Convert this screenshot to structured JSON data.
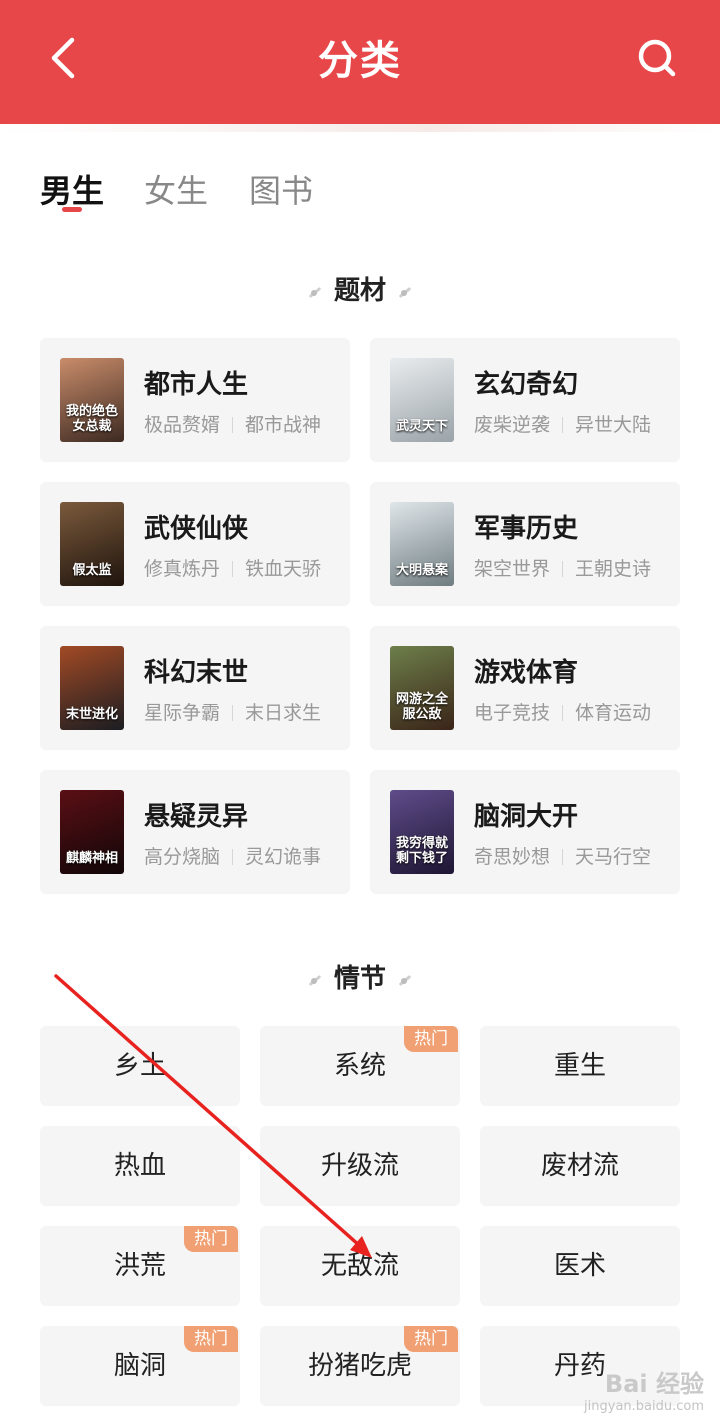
{
  "header": {
    "title": "分类"
  },
  "tabs": [
    {
      "label": "男生",
      "active": true
    },
    {
      "label": "女生",
      "active": false
    },
    {
      "label": "图书",
      "active": false
    }
  ],
  "sections": {
    "theme": "题材",
    "plot": "情节"
  },
  "categories": [
    {
      "title": "都市人生",
      "tags": [
        "极品赘婿",
        "都市战神"
      ],
      "cover_text": "我的绝色女总裁",
      "cover_colors": [
        "#c98c6a",
        "#3d2a22"
      ]
    },
    {
      "title": "玄幻奇幻",
      "tags": [
        "废柴逆袭",
        "异世大陆"
      ],
      "cover_text": "武灵天下",
      "cover_colors": [
        "#e9ecef",
        "#9aa3a8"
      ]
    },
    {
      "title": "武侠仙侠",
      "tags": [
        "修真炼丹",
        "铁血天骄"
      ],
      "cover_text": "假太监",
      "cover_colors": [
        "#7b5a3c",
        "#1f140d"
      ]
    },
    {
      "title": "军事历史",
      "tags": [
        "架空世界",
        "王朝史诗"
      ],
      "cover_text": "大明悬案",
      "cover_colors": [
        "#dfe6ea",
        "#6f7c80"
      ]
    },
    {
      "title": "科幻末世",
      "tags": [
        "星际争霸",
        "末日求生"
      ],
      "cover_text": "末世进化",
      "cover_colors": [
        "#a24a25",
        "#1b1d22"
      ]
    },
    {
      "title": "游戏体育",
      "tags": [
        "电子竞技",
        "体育运动"
      ],
      "cover_text": "网游之全服公敌",
      "cover_colors": [
        "#6d7f4a",
        "#3a2418"
      ]
    },
    {
      "title": "悬疑灵异",
      "tags": [
        "高分烧脑",
        "灵幻诡事"
      ],
      "cover_text": "麒麟神相",
      "cover_colors": [
        "#5a0f14",
        "#100608"
      ]
    },
    {
      "title": "脑洞大开",
      "tags": [
        "奇思妙想",
        "天马行空"
      ],
      "cover_text": "我穷得就剩下钱了",
      "cover_colors": [
        "#5f4c8a",
        "#1e1633"
      ]
    }
  ],
  "plots": [
    {
      "label": "乡土",
      "hot": false
    },
    {
      "label": "系统",
      "hot": true
    },
    {
      "label": "重生",
      "hot": false
    },
    {
      "label": "热血",
      "hot": false
    },
    {
      "label": "升级流",
      "hot": false
    },
    {
      "label": "废材流",
      "hot": false
    },
    {
      "label": "洪荒",
      "hot": true
    },
    {
      "label": "无敌流",
      "hot": false
    },
    {
      "label": "医术",
      "hot": false
    },
    {
      "label": "脑洞",
      "hot": true
    },
    {
      "label": "扮猪吃虎",
      "hot": true
    },
    {
      "label": "丹药",
      "hot": false
    }
  ],
  "hot_label": "热门",
  "watermark": {
    "logo": "Bai 经验",
    "url": "jingyan.baidu.com"
  },
  "colors": {
    "accent": "#e8474a",
    "hot_badge": "#f0a072",
    "card_bg": "#f5f5f5",
    "annotation_arrow": "#e8231f"
  }
}
